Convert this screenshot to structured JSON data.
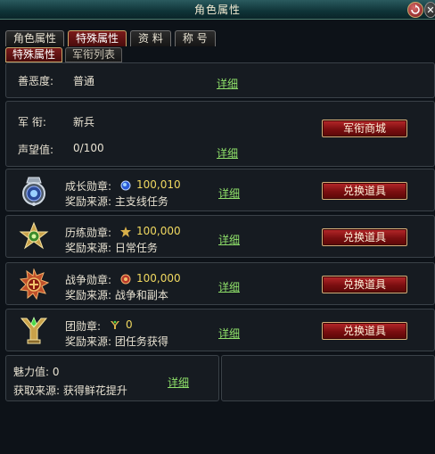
{
  "window": {
    "title": "角色属性",
    "min_icon": "minimize-icon",
    "close_icon": "close-icon"
  },
  "tabs": [
    {
      "label": "角色属性",
      "active": false
    },
    {
      "label": "特殊属性",
      "active": true
    },
    {
      "label": "资 料",
      "active": false
    },
    {
      "label": "称 号",
      "active": false
    }
  ],
  "subtabs": [
    {
      "label": "特殊属性",
      "active": true
    },
    {
      "label": "军衔列表",
      "active": false
    }
  ],
  "karma": {
    "label": "善恶度:",
    "value": "普通",
    "link": "详细"
  },
  "rank": {
    "rank_label": "军  衔:",
    "rank_value": "新兵",
    "fame_label": "声望值:",
    "fame_value": "0/100",
    "link": "详细",
    "shop_button": "军衔商城"
  },
  "medals": [
    {
      "name": "成长勋章:",
      "icon": "growth-medal-icon",
      "count_icon": "blue-gem-icon",
      "count": "100,010",
      "source": "奖励来源: 主支线任务",
      "link": "详细",
      "button": "兑换道具"
    },
    {
      "name": "历练勋章:",
      "icon": "experience-medal-icon",
      "count_icon": "gold-star-icon",
      "count": "100,000",
      "source": "奖励来源: 日常任务",
      "link": "详细",
      "button": "兑换道具"
    },
    {
      "name": "战争勋章:",
      "icon": "war-medal-icon",
      "count_icon": "red-emblem-icon",
      "count": "100,000",
      "source": "奖励来源: 战争和副本",
      "link": "详细",
      "button": "兑换道具"
    },
    {
      "name": "团勋章:",
      "icon": "team-medal-icon",
      "count_icon": "team-trophy-icon",
      "count": "0",
      "source": "奖励来源: 团任务获得",
      "link": "详细",
      "button": "兑换道具"
    }
  ],
  "charm": {
    "label": "魅力值: 0",
    "source": "获取来源: 获得鲜花提升",
    "link": "详细"
  },
  "colors": {
    "accent_red": "#8a1416",
    "link_green": "#8fe06a",
    "value_gold": "#f0d860"
  }
}
